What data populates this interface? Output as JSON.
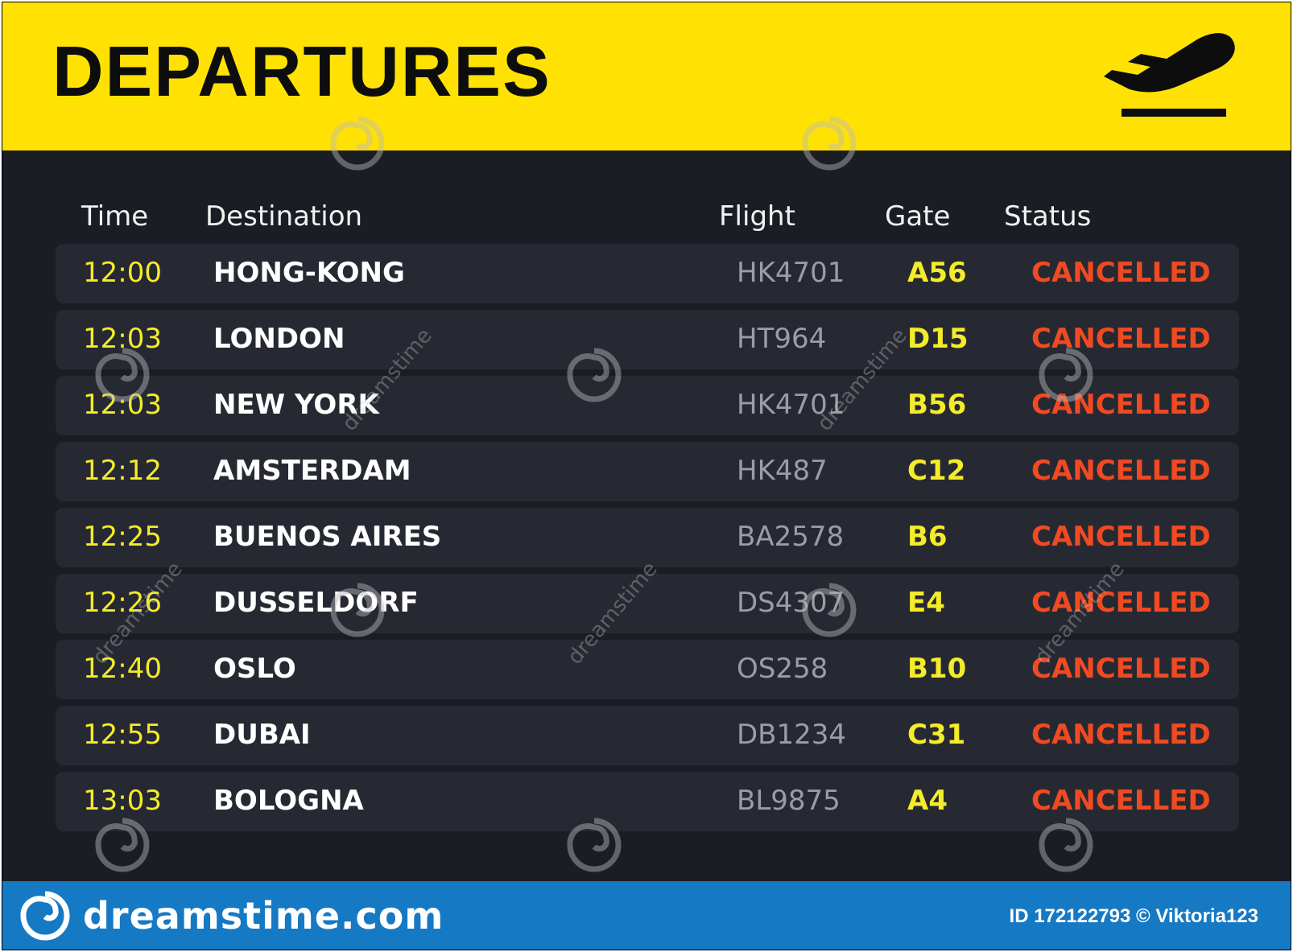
{
  "header": {
    "title": "DEPARTURES",
    "icon": "airplane-departure-icon",
    "background_color": "#ffe203"
  },
  "board": {
    "columns": {
      "time": "Time",
      "destination": "Destination",
      "flight": "Flight",
      "gate": "Gate",
      "status": "Status"
    },
    "rows": [
      {
        "time": "12:00",
        "destination": "HONG-KONG",
        "flight": "HK4701",
        "gate": "A56",
        "status": "CANCELLED"
      },
      {
        "time": "12:03",
        "destination": "LONDON",
        "flight": "HT964",
        "gate": "D15",
        "status": "CANCELLED"
      },
      {
        "time": "12:03",
        "destination": "NEW YORK",
        "flight": "HK4701",
        "gate": "B56",
        "status": "CANCELLED"
      },
      {
        "time": "12:12",
        "destination": "AMSTERDAM",
        "flight": "HK487",
        "gate": "C12",
        "status": "CANCELLED"
      },
      {
        "time": "12:25",
        "destination": "BUENOS AIRES",
        "flight": "BA2578",
        "gate": "B6",
        "status": "CANCELLED"
      },
      {
        "time": "12:26",
        "destination": "DUSSELDORF",
        "flight": "DS4307",
        "gate": "E4",
        "status": "CANCELLED"
      },
      {
        "time": "12:40",
        "destination": "OSLO",
        "flight": "OS258",
        "gate": "B10",
        "status": "CANCELLED"
      },
      {
        "time": "12:55",
        "destination": "DUBAI",
        "flight": "DB1234",
        "gate": "C31",
        "status": "CANCELLED"
      },
      {
        "time": "13:03",
        "destination": "BOLOGNA",
        "flight": "BL9875",
        "gate": "A4",
        "status": "CANCELLED"
      }
    ],
    "colors": {
      "time": "#f4ec2a",
      "destination": "#ffffff",
      "flight": "#9a9ca6",
      "gate": "#f4ec2a",
      "status": "#f04a23",
      "background": "#1b1d25",
      "row": "#262932"
    }
  },
  "footer": {
    "brand": "dreamstime.com",
    "brand_icon": "dreamstime-spiral-icon",
    "credit": "ID 172122793 © Viktoria123",
    "background_color": "#1679c4"
  },
  "watermark": {
    "text": "dreamstime"
  }
}
